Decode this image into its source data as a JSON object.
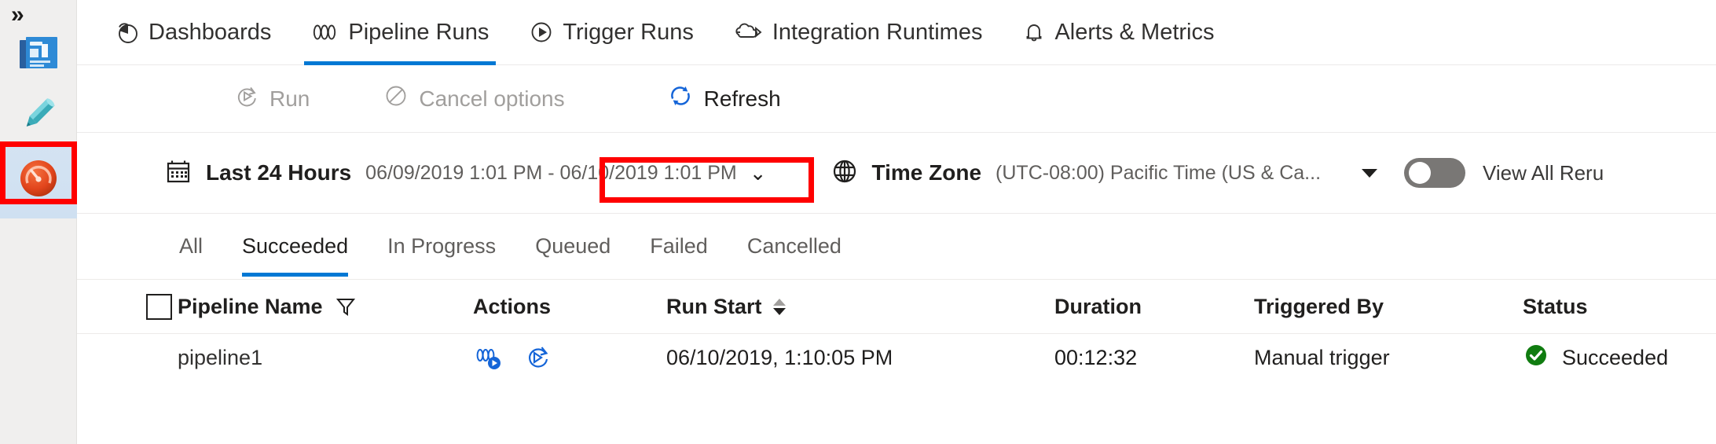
{
  "sidebar": {
    "expand_label": "»",
    "items": [
      {
        "name": "overview-icon",
        "label": "Overview",
        "selected": false
      },
      {
        "name": "author-pencil-icon",
        "label": "Author",
        "selected": false
      },
      {
        "name": "monitor-gauge-icon",
        "label": "Monitor",
        "selected": true
      }
    ]
  },
  "nav": {
    "tabs": [
      {
        "label": "Dashboards",
        "icon": "pie-chart-icon",
        "active": false
      },
      {
        "label": "Pipeline Runs",
        "icon": "pipeline-icon",
        "active": true
      },
      {
        "label": "Trigger Runs",
        "icon": "play-circle-icon",
        "active": false
      },
      {
        "label": "Integration Runtimes",
        "icon": "integration-runtime-icon",
        "active": false
      },
      {
        "label": "Alerts & Metrics",
        "icon": "bell-icon",
        "active": false
      }
    ]
  },
  "toolbar": {
    "run_label": "Run",
    "cancel_label": "Cancel options",
    "refresh_label": "Refresh",
    "run_enabled": false,
    "cancel_enabled": false,
    "refresh_enabled": true,
    "highlight_color": "#ff0000"
  },
  "filters": {
    "date_icon": "calendar-icon",
    "date_label": "Last 24 Hours",
    "date_range": "06/09/2019 1:01 PM - 06/10/2019 1:01 PM",
    "timezone_icon": "globe-icon",
    "timezone_label": "Time Zone",
    "timezone_value": "(UTC-08:00) Pacific Time (US & Ca...",
    "view_all_reruns_label": "View All Reru",
    "view_all_reruns_on": false
  },
  "status_tabs": [
    {
      "label": "All",
      "active": false
    },
    {
      "label": "Succeeded",
      "active": true
    },
    {
      "label": "In Progress",
      "active": false
    },
    {
      "label": "Queued",
      "active": false
    },
    {
      "label": "Failed",
      "active": false
    },
    {
      "label": "Cancelled",
      "active": false
    }
  ],
  "table": {
    "columns": [
      {
        "key": "select",
        "label": ""
      },
      {
        "key": "pipeline_name",
        "label": "Pipeline Name"
      },
      {
        "key": "actions",
        "label": "Actions"
      },
      {
        "key": "run_start",
        "label": "Run Start"
      },
      {
        "key": "duration",
        "label": "Duration"
      },
      {
        "key": "triggered_by",
        "label": "Triggered By"
      },
      {
        "key": "status",
        "label": "Status"
      }
    ],
    "rows": [
      {
        "pipeline_name": "pipeline1",
        "actions": [
          "view-activity-runs-icon",
          "rerun-icon"
        ],
        "run_start": "06/10/2019, 1:10:05 PM",
        "duration": "00:12:32",
        "triggered_by": "Manual trigger",
        "status": "Succeeded",
        "status_color": "#107c10"
      }
    ]
  },
  "colors": {
    "accent": "#0078d4",
    "success": "#107c10",
    "highlight": "#ff0000",
    "rail_bg": "#f0efee"
  }
}
